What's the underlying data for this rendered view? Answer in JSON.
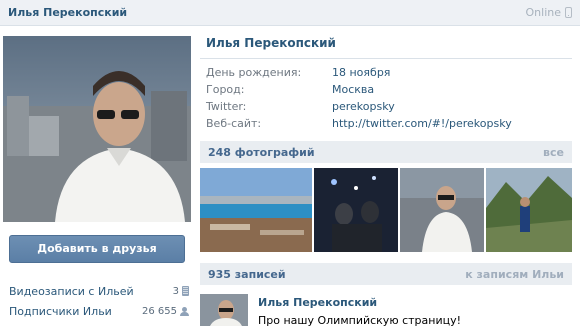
{
  "topbar": {
    "name": "Илья Перекопский",
    "status": "Online"
  },
  "profile": {
    "name": "Илья Перекопский",
    "info": [
      {
        "label": "День рождения:",
        "value": "18 ноября"
      },
      {
        "label": "Город:",
        "value": "Москва"
      },
      {
        "label": "Twitter:",
        "value": "perekopsky"
      },
      {
        "label": "Веб-сайт:",
        "value": "http://twitter.com/#!/perekopsky"
      }
    ]
  },
  "actions": {
    "add_friend": "Добавить в друзья"
  },
  "side_links": [
    {
      "label": "Видеозаписи с Ильей",
      "count": "3",
      "icon": "film-icon"
    },
    {
      "label": "Подписчики Ильи",
      "count": "26 655",
      "icon": "people-icon"
    }
  ],
  "photos": {
    "title": "248 фотографий",
    "all": "все"
  },
  "wall": {
    "title": "935 записей",
    "link": "к записям Ильи"
  },
  "post": {
    "author": "Илья Перекопский",
    "text": "Про нашу Олимпийскую страницу!"
  }
}
